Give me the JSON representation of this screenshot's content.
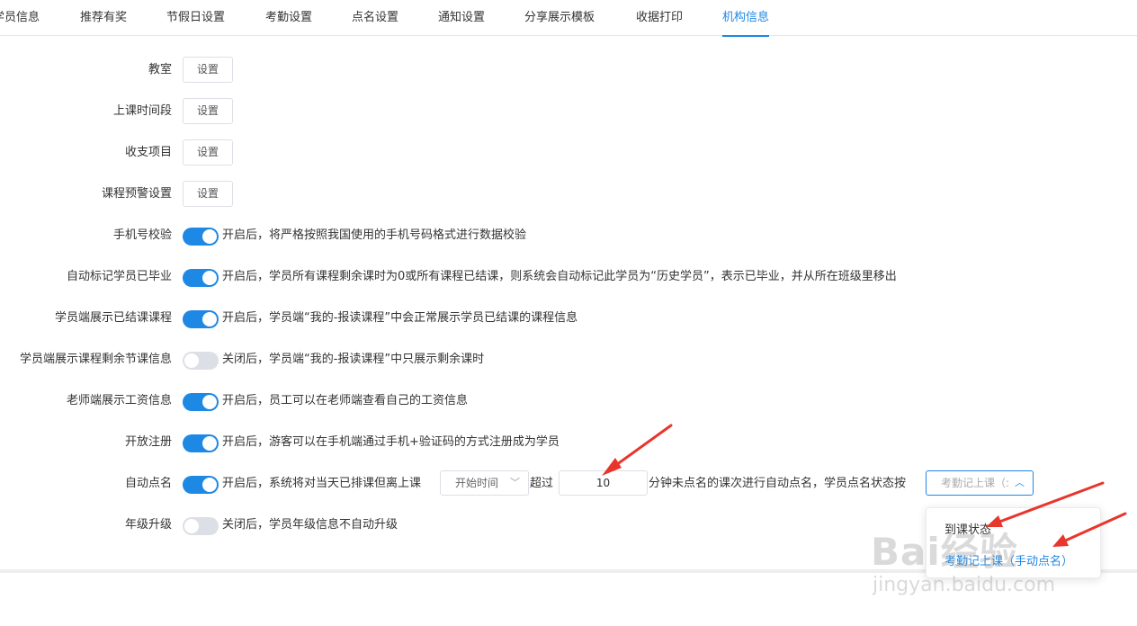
{
  "tabs": [
    {
      "label": "学员信息"
    },
    {
      "label": "推荐有奖"
    },
    {
      "label": "节假日设置"
    },
    {
      "label": "考勤设置"
    },
    {
      "label": "点名设置"
    },
    {
      "label": "通知设置"
    },
    {
      "label": "分享展示模板"
    },
    {
      "label": "收据打印"
    },
    {
      "label": "机构信息",
      "active": true
    }
  ],
  "settings_buttons": [
    {
      "label": "教室",
      "button": "设置"
    },
    {
      "label": "上课时间段",
      "button": "设置"
    },
    {
      "label": "收支项目",
      "button": "设置"
    },
    {
      "label": "课程预警设置",
      "button": "设置"
    }
  ],
  "toggles": [
    {
      "label": "手机号校验",
      "on": true,
      "desc": "开启后，将严格按照我国使用的手机号码格式进行数据校验"
    },
    {
      "label": "自动标记学员已毕业",
      "on": true,
      "desc": "开启后，学员所有课程剩余课时为0或所有课程已结课，则系统会自动标记此学员为“历史学员”，表示已毕业，并从所在班级里移出"
    },
    {
      "label": "学员端展示已结课课程",
      "on": true,
      "desc": "开启后，学员端“我的-报读课程”中会正常展示学员已结课的课程信息"
    },
    {
      "label": "学员端展示课程剩余节课信息",
      "on": false,
      "desc": "关闭后，学员端“我的-报读课程”中只展示剩余课时"
    },
    {
      "label": "老师端展示工资信息",
      "on": true,
      "desc": "开启后，员工可以在老师端查看自己的工资信息"
    },
    {
      "label": "开放注册",
      "on": true,
      "desc": "开启后，游客可以在手机端通过手机+验证码的方式注册成为学员"
    }
  ],
  "auto_rollcall": {
    "label": "自动点名",
    "on": true,
    "text1": "开启后，系统将对当天已排课但离上课",
    "time_select": "开始时间",
    "text2": "超过",
    "minutes": "10",
    "text3": "分钟未点名的课次进行自动点名，学员点名状态按",
    "status_select": "考勤记上课（:"
  },
  "grade_upgrade": {
    "label": "年级升级",
    "on": false,
    "desc": "关闭后，学员年级信息不自动升级"
  },
  "dropdown": {
    "items": [
      {
        "label": "到课状态",
        "disabled": true
      },
      {
        "label": "考勤记上课（手动点名）",
        "selected": true
      }
    ]
  },
  "watermark": {
    "logo": "Bai经验",
    "url": "jingyan.baidu.com"
  },
  "colors": {
    "accent": "#1e88e5",
    "annotation_red": "#e8362d",
    "switch_off": "#dcdfe6"
  }
}
